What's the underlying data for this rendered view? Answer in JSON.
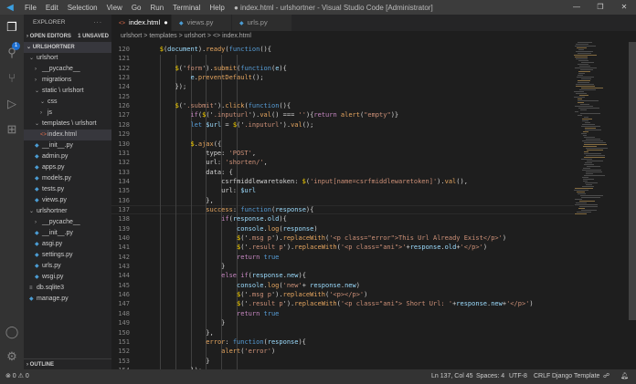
{
  "titlebar": {
    "menu": [
      "File",
      "Edit",
      "Selection",
      "View",
      "Go",
      "Run",
      "Terminal",
      "Help"
    ],
    "title": "● index.html - urlshortner - Visual Studio Code [Administrator]"
  },
  "activity": {
    "badge": "1"
  },
  "sidebar": {
    "title": "EXPLORER",
    "more": "···",
    "open_editors": "OPEN EDITORS",
    "unsaved": "1 UNSAVED",
    "project": "URLSHORTNER",
    "outline": "OUTLINE",
    "tree": [
      {
        "label": "urlshort",
        "depth": 1,
        "chev": "v",
        "icon": ""
      },
      {
        "label": "__pycache__",
        "depth": 2,
        "chev": ">",
        "icon": ""
      },
      {
        "label": "migrations",
        "depth": 2,
        "chev": ">",
        "icon": ""
      },
      {
        "label": "static \\ urlshort",
        "depth": 2,
        "chev": "v",
        "icon": ""
      },
      {
        "label": "css",
        "depth": 3,
        "chev": "v",
        "icon": ""
      },
      {
        "label": "js",
        "depth": 3,
        "chev": ">",
        "icon": ""
      },
      {
        "label": "templates \\ urlshort",
        "depth": 2,
        "chev": "v",
        "icon": ""
      },
      {
        "label": "index.html",
        "depth": 3,
        "chev": "",
        "icon": "html",
        "selected": true
      },
      {
        "label": "__init__.py",
        "depth": 2,
        "chev": "",
        "icon": "py"
      },
      {
        "label": "admin.py",
        "depth": 2,
        "chev": "",
        "icon": "py"
      },
      {
        "label": "apps.py",
        "depth": 2,
        "chev": "",
        "icon": "py"
      },
      {
        "label": "models.py",
        "depth": 2,
        "chev": "",
        "icon": "py"
      },
      {
        "label": "tests.py",
        "depth": 2,
        "chev": "",
        "icon": "py"
      },
      {
        "label": "views.py",
        "depth": 2,
        "chev": "",
        "icon": "py"
      },
      {
        "label": "urlshortner",
        "depth": 1,
        "chev": "v",
        "icon": ""
      },
      {
        "label": "__pycache__",
        "depth": 2,
        "chev": ">",
        "icon": ""
      },
      {
        "label": "__init__.py",
        "depth": 2,
        "chev": "",
        "icon": "py"
      },
      {
        "label": "asgi.py",
        "depth": 2,
        "chev": "",
        "icon": "py"
      },
      {
        "label": "settings.py",
        "depth": 2,
        "chev": "",
        "icon": "py"
      },
      {
        "label": "urls.py",
        "depth": 2,
        "chev": "",
        "icon": "py"
      },
      {
        "label": "wsgi.py",
        "depth": 2,
        "chev": "",
        "icon": "py"
      },
      {
        "label": "db.sqlite3",
        "depth": 1,
        "chev": "",
        "icon": "db"
      },
      {
        "label": "manage.py",
        "depth": 1,
        "chev": "",
        "icon": "py"
      }
    ]
  },
  "tabs": [
    {
      "label": "index.html",
      "icon": "html",
      "active": true,
      "dirty": "●"
    },
    {
      "label": "views.py",
      "icon": "py"
    },
    {
      "label": "urls.py",
      "icon": "py"
    }
  ],
  "breadcrumb": "urlshort > templates > urlshort > <> index.html",
  "editor": {
    "first_line": 120,
    "cursor_line": 137,
    "lines": [
      [
        [
          "        ",
          "p"
        ],
        [
          "$",
          "g"
        ],
        [
          "(",
          "p"
        ],
        [
          "document",
          "v"
        ],
        [
          ").",
          "p"
        ],
        [
          "ready",
          "f"
        ],
        [
          "(",
          "p"
        ],
        [
          "function",
          "b"
        ],
        [
          "(){",
          "p"
        ]
      ],
      [
        [
          "",
          "p"
        ]
      ],
      [
        [
          "            ",
          "p"
        ],
        [
          "$",
          "g"
        ],
        [
          "('",
          "p"
        ],
        [
          "form",
          "s"
        ],
        [
          "').",
          "p"
        ],
        [
          "submit",
          "f"
        ],
        [
          "(",
          "p"
        ],
        [
          "function",
          "b"
        ],
        [
          "(",
          "p"
        ],
        [
          "e",
          "v"
        ],
        [
          "){",
          "p"
        ]
      ],
      [
        [
          "                ",
          "p"
        ],
        [
          "e",
          "v"
        ],
        [
          ".",
          "p"
        ],
        [
          "preventDefault",
          "f"
        ],
        [
          "();",
          "p"
        ]
      ],
      [
        [
          "            });",
          "p"
        ]
      ],
      [
        [
          "",
          "p"
        ]
      ],
      [
        [
          "            ",
          "p"
        ],
        [
          "$",
          "g"
        ],
        [
          "('",
          "p"
        ],
        [
          ".submit",
          "s"
        ],
        [
          "').",
          "p"
        ],
        [
          "click",
          "f"
        ],
        [
          "(",
          "p"
        ],
        [
          "function",
          "b"
        ],
        [
          "(){",
          "p"
        ]
      ],
      [
        [
          "                ",
          "p"
        ],
        [
          "if",
          "k"
        ],
        [
          "(",
          "p"
        ],
        [
          "$",
          "g"
        ],
        [
          "('",
          "p"
        ],
        [
          ".inputurl",
          "s"
        ],
        [
          "').",
          "p"
        ],
        [
          "val",
          "f"
        ],
        [
          "() === ",
          "p"
        ],
        [
          "''",
          "s"
        ],
        [
          "){",
          "p"
        ],
        [
          "return ",
          "k"
        ],
        [
          "alert",
          "f"
        ],
        [
          "(",
          "p"
        ],
        [
          "\"empty\"",
          "s"
        ],
        [
          ")}",
          "p"
        ]
      ],
      [
        [
          "                ",
          "p"
        ],
        [
          "let ",
          "b"
        ],
        [
          "$url",
          "v"
        ],
        [
          " = ",
          "p"
        ],
        [
          "$",
          "g"
        ],
        [
          "('",
          "p"
        ],
        [
          ".inputurl",
          "s"
        ],
        [
          "').",
          "p"
        ],
        [
          "val",
          "f"
        ],
        [
          "();",
          "p"
        ]
      ],
      [
        [
          "",
          "p"
        ]
      ],
      [
        [
          "                ",
          "p"
        ],
        [
          "$",
          "g"
        ],
        [
          ".",
          "p"
        ],
        [
          "ajax",
          "f"
        ],
        [
          "({",
          "p"
        ]
      ],
      [
        [
          "                    type: ",
          "p"
        ],
        [
          "'POST'",
          "s"
        ],
        [
          ",",
          "p"
        ]
      ],
      [
        [
          "                    url: ",
          "p"
        ],
        [
          "'shorten/'",
          "s"
        ],
        [
          ",",
          "p"
        ]
      ],
      [
        [
          "                    data: {",
          "p"
        ]
      ],
      [
        [
          "                        csrfmiddlewaretoken: ",
          "p"
        ],
        [
          "$",
          "g"
        ],
        [
          "(",
          "p"
        ],
        [
          "'input[name=csrfmiddlewaretoken]'",
          "s"
        ],
        [
          ").",
          "p"
        ],
        [
          "val",
          "f"
        ],
        [
          "(),",
          "p"
        ]
      ],
      [
        [
          "                        url: ",
          "p"
        ],
        [
          "$url",
          "v"
        ]
      ],
      [
        [
          "                    },",
          "p"
        ]
      ],
      [
        [
          "                    ",
          "p"
        ],
        [
          "success",
          "f"
        ],
        [
          ": ",
          "p"
        ],
        [
          "function",
          "b"
        ],
        [
          "(",
          "p"
        ],
        [
          "response",
          "v"
        ],
        [
          "){",
          "p"
        ]
      ],
      [
        [
          "                        ",
          "p"
        ],
        [
          "if",
          "k"
        ],
        [
          "(",
          "p"
        ],
        [
          "response",
          "v"
        ],
        [
          ".",
          "p"
        ],
        [
          "old",
          "v"
        ],
        [
          "){",
          "p"
        ]
      ],
      [
        [
          "                            ",
          "p"
        ],
        [
          "console",
          "v"
        ],
        [
          ".",
          "p"
        ],
        [
          "log",
          "f"
        ],
        [
          "(",
          "p"
        ],
        [
          "response",
          "v"
        ],
        [
          ")",
          "p"
        ]
      ],
      [
        [
          "                            ",
          "p"
        ],
        [
          "$",
          "g"
        ],
        [
          "('",
          "p"
        ],
        [
          ".msg p",
          "s"
        ],
        [
          "').",
          "p"
        ],
        [
          "replaceWith",
          "f"
        ],
        [
          "(",
          "p"
        ],
        [
          "'<p class=\"error\">This Url Already Exist</p>'",
          "s"
        ],
        [
          ")",
          "p"
        ]
      ],
      [
        [
          "                            ",
          "p"
        ],
        [
          "$",
          "g"
        ],
        [
          "('",
          "p"
        ],
        [
          ".result p",
          "s"
        ],
        [
          "').",
          "p"
        ],
        [
          "replaceWith",
          "f"
        ],
        [
          "(",
          "p"
        ],
        [
          "'<p class=\"ani\">'",
          "s"
        ],
        [
          "+",
          "p"
        ],
        [
          "response",
          "v"
        ],
        [
          ".",
          "p"
        ],
        [
          "old",
          "v"
        ],
        [
          "+",
          "p"
        ],
        [
          "'</p>'",
          "s"
        ],
        [
          ")",
          "p"
        ]
      ],
      [
        [
          "                            ",
          "p"
        ],
        [
          "return ",
          "k"
        ],
        [
          "true",
          "b"
        ]
      ],
      [
        [
          "                        }",
          "p"
        ]
      ],
      [
        [
          "                        ",
          "p"
        ],
        [
          "else ",
          "k"
        ],
        [
          "if",
          "k"
        ],
        [
          "(",
          "p"
        ],
        [
          "response",
          "v"
        ],
        [
          ".",
          "p"
        ],
        [
          "new",
          "v"
        ],
        [
          "){",
          "p"
        ]
      ],
      [
        [
          "                            ",
          "p"
        ],
        [
          "console",
          "v"
        ],
        [
          ".",
          "p"
        ],
        [
          "log",
          "f"
        ],
        [
          "(",
          "p"
        ],
        [
          "'new'",
          "s"
        ],
        [
          "+ ",
          "p"
        ],
        [
          "response",
          "v"
        ],
        [
          ".",
          "p"
        ],
        [
          "new",
          "v"
        ],
        [
          ")",
          "p"
        ]
      ],
      [
        [
          "                            ",
          "p"
        ],
        [
          "$",
          "g"
        ],
        [
          "('",
          "p"
        ],
        [
          ".msg p",
          "s"
        ],
        [
          "').",
          "p"
        ],
        [
          "replaceWith",
          "f"
        ],
        [
          "(",
          "p"
        ],
        [
          "'<p></p>'",
          "s"
        ],
        [
          ")",
          "p"
        ]
      ],
      [
        [
          "                            ",
          "p"
        ],
        [
          "$",
          "g"
        ],
        [
          "('",
          "p"
        ],
        [
          ".result p",
          "s"
        ],
        [
          "').",
          "p"
        ],
        [
          "replaceWith",
          "f"
        ],
        [
          "(",
          "p"
        ],
        [
          "'<p class=\"ani\"> Short Url: '",
          "s"
        ],
        [
          "+",
          "p"
        ],
        [
          "response",
          "v"
        ],
        [
          ".",
          "p"
        ],
        [
          "new",
          "v"
        ],
        [
          "+",
          "p"
        ],
        [
          "'</p>'",
          "s"
        ],
        [
          ")",
          "p"
        ]
      ],
      [
        [
          "                            ",
          "p"
        ],
        [
          "return ",
          "k"
        ],
        [
          "true",
          "b"
        ]
      ],
      [
        [
          "                        }",
          "p"
        ]
      ],
      [
        [
          "                    },",
          "p"
        ]
      ],
      [
        [
          "                    ",
          "p"
        ],
        [
          "error",
          "f"
        ],
        [
          ": ",
          "p"
        ],
        [
          "function",
          "b"
        ],
        [
          "(",
          "p"
        ],
        [
          "response",
          "v"
        ],
        [
          "){",
          "p"
        ]
      ],
      [
        [
          "                        ",
          "p"
        ],
        [
          "alert",
          "f"
        ],
        [
          "(",
          "p"
        ],
        [
          "'error'",
          "s"
        ],
        [
          ")",
          "p"
        ]
      ],
      [
        [
          "                    }",
          "p"
        ]
      ],
      [
        [
          "                });",
          "p"
        ]
      ]
    ]
  },
  "status": {
    "problems": "⊗ 0 ⚠ 0",
    "position": "Ln 137, Col 45",
    "spaces": "Spaces: 4",
    "encoding": "UTF-8",
    "eol": "CRLF",
    "language": "Django Template"
  }
}
